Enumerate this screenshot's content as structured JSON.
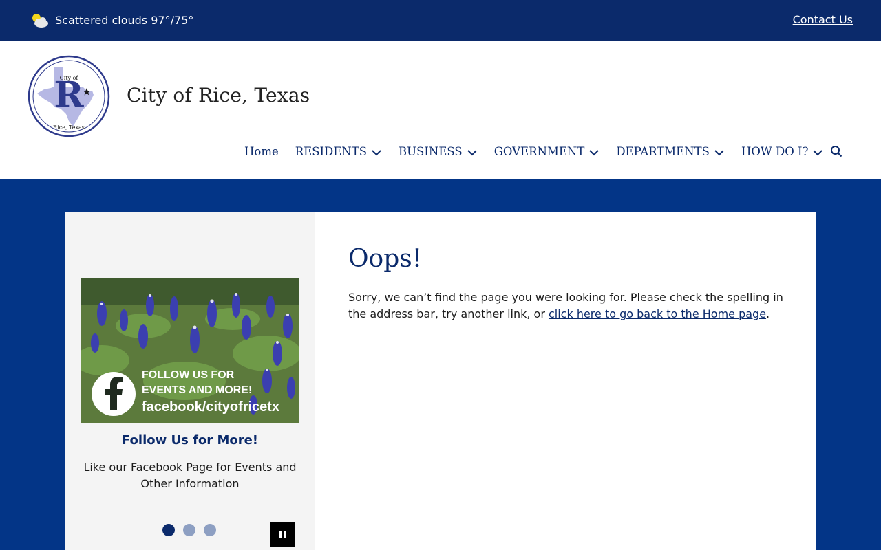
{
  "topbar": {
    "weather_text": "Scattered clouds 97°/75°",
    "weather_icon": "partly-cloudy-icon",
    "contact_label": "Contact Us"
  },
  "header": {
    "seal_text_top": "City of",
    "seal_letter": "R",
    "seal_text_bottom": "Rice, Texas",
    "site_title": "City of Rice, Texas"
  },
  "nav": {
    "items": [
      {
        "label": "Home"
      },
      {
        "label": "RESIDENTS"
      },
      {
        "label": "BUSINESS"
      },
      {
        "label": "GOVERNMENT"
      },
      {
        "label": "DEPARTMENTS"
      },
      {
        "label": "HOW DO I?"
      }
    ]
  },
  "slideshow": {
    "image_text_line1": "FOLLOW US FOR",
    "image_text_line2": "EVENTS AND MORE!",
    "image_text_line3": "facebook/cityofricetx",
    "title": "Follow Us for More!",
    "description": "Like our Facebook Page for Events and Other Information",
    "current_slide": 1,
    "slide_count": 3
  },
  "content": {
    "heading": "Oops!",
    "message_before": "Sorry, we can’t find the page you were looking for. Please check the spelling in the address bar, try another link, or ",
    "home_link": "click here to go back to the Home page",
    "message_after": "."
  },
  "colors": {
    "navy": "#0b2a6b",
    "band_blue": "#033587",
    "dot_inactive": "#8d9fc2",
    "sidebar_bg": "#f4f4f4"
  }
}
